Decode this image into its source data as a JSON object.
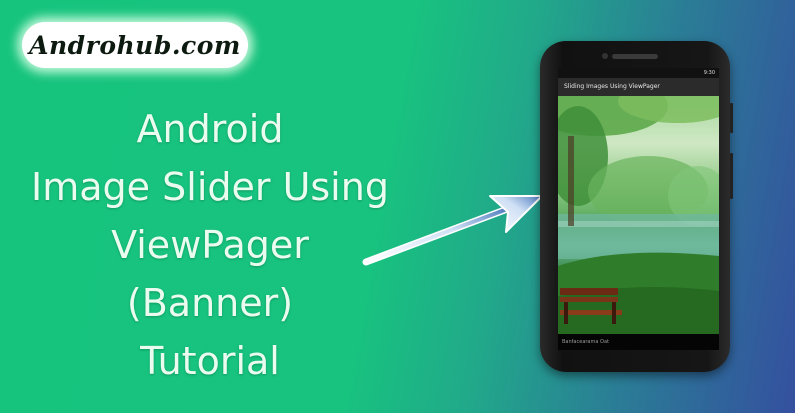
{
  "logo": {
    "text": "Androhub.com"
  },
  "headline": {
    "lines": [
      "Android",
      "Image Slider Using",
      "ViewPager",
      "(Banner)",
      "Tutorial"
    ]
  },
  "phone": {
    "status_time": "9:30",
    "app_title": "Sliding Images Using ViewPager",
    "nav_text": "Banfacearama Oat"
  },
  "colors": {
    "background_start": "#16c47e",
    "background_end": "#34509f",
    "headline_text": "#eafcef",
    "arrow": "#3f6fb5"
  }
}
